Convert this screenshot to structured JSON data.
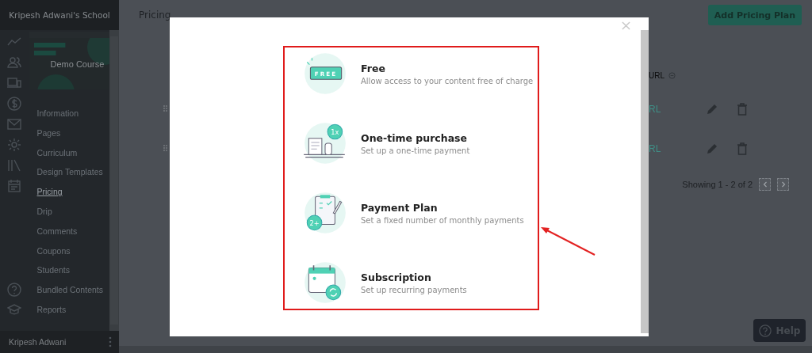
{
  "sidebar": {
    "school": "Kripesh Adwani's School",
    "course_title": "Demo Course",
    "items": [
      {
        "label": "Information",
        "selected": false
      },
      {
        "label": "Pages",
        "selected": false
      },
      {
        "label": "Curriculum",
        "selected": false
      },
      {
        "label": "Design Templates",
        "selected": false
      },
      {
        "label": "Pricing",
        "selected": true
      },
      {
        "label": "Drip",
        "selected": false
      },
      {
        "label": "Comments",
        "selected": false
      },
      {
        "label": "Coupons",
        "selected": false
      },
      {
        "label": "Students",
        "selected": false
      },
      {
        "label": "Bundled Contents",
        "selected": false
      },
      {
        "label": "Reports",
        "selected": false
      }
    ],
    "user": "Kripesh Adwani"
  },
  "page": {
    "title": "Pricing",
    "add_button": "Add Pricing Plan",
    "column_header": "URL",
    "rows": [
      {
        "link": "RL"
      },
      {
        "link": "RL"
      }
    ],
    "pagination": "Showing 1 - 2 of 2"
  },
  "modal": {
    "options": [
      {
        "kind": "free",
        "badge": "FREE",
        "title": "Free",
        "description": "Allow access to your content free of charge"
      },
      {
        "kind": "one-time",
        "badge": "1x",
        "title": "One-time purchase",
        "description": "Set up a one-time payment"
      },
      {
        "kind": "plan",
        "badge": "2+",
        "title": "Payment Plan",
        "description": "Set a fixed number of monthly payments"
      },
      {
        "kind": "subscription",
        "title": "Subscription",
        "description": "Set up recurring payments"
      }
    ]
  },
  "help_button": "Help"
}
